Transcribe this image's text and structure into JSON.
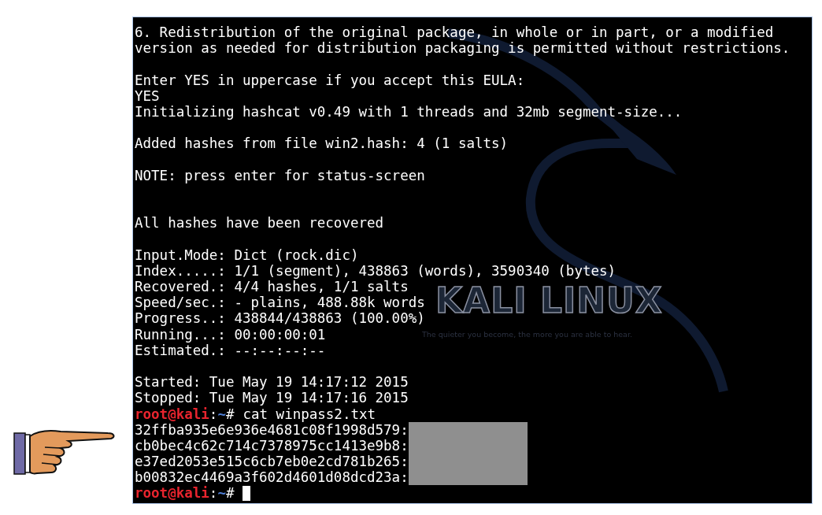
{
  "terminal": {
    "wallpaper": {
      "logo_text": "KALI LINUX",
      "tagline": "The quieter you become, the more you are able to hear."
    },
    "lines": [
      {
        "kind": "text",
        "text": "6. Redistribution of the original package, in whole or in part, or a modified"
      },
      {
        "kind": "text",
        "text": "version as needed for distribution packaging is permitted without restrictions."
      },
      {
        "kind": "blank"
      },
      {
        "kind": "text",
        "text": "Enter YES in uppercase if you accept this EULA:"
      },
      {
        "kind": "text",
        "text": "YES"
      },
      {
        "kind": "text",
        "text": "Initializing hashcat v0.49 with 1 threads and 32mb segment-size..."
      },
      {
        "kind": "blank"
      },
      {
        "kind": "text",
        "text": "Added hashes from file win2.hash: 4 (1 salts)"
      },
      {
        "kind": "blank"
      },
      {
        "kind": "text",
        "text": "NOTE: press enter for status-screen"
      },
      {
        "kind": "blank"
      },
      {
        "kind": "blank"
      },
      {
        "kind": "text",
        "text": "All hashes have been recovered"
      },
      {
        "kind": "blank"
      },
      {
        "kind": "text",
        "text": "Input.Mode: Dict (rock.dic)"
      },
      {
        "kind": "text",
        "text": "Index.....: 1/1 (segment), 438863 (words), 3590340 (bytes)"
      },
      {
        "kind": "text",
        "text": "Recovered.: 4/4 hashes, 1/1 salts"
      },
      {
        "kind": "text",
        "text": "Speed/sec.: - plains, 488.88k words"
      },
      {
        "kind": "text",
        "text": "Progress..: 438844/438863 (100.00%)"
      },
      {
        "kind": "text",
        "text": "Running...: 00:00:00:01"
      },
      {
        "kind": "text",
        "text": "Estimated.: --:--:--:--"
      },
      {
        "kind": "blank"
      },
      {
        "kind": "text",
        "text": "Started: Tue May 19 14:17:12 2015"
      },
      {
        "kind": "text",
        "text": "Stopped: Tue May 19 14:17:16 2015"
      },
      {
        "kind": "prompt",
        "user_host": "root@kali",
        "separator": ":",
        "path": "~",
        "symbol": "#",
        "command": "cat winpass2.txt"
      },
      {
        "kind": "hash",
        "text": "32ffba935e6e936e4681c08f1998d579:",
        "redacted": true
      },
      {
        "kind": "hash",
        "text": "cb0bec4c62c714c7378975cc1413e9b8:",
        "redacted": true
      },
      {
        "kind": "hash",
        "text": "e37ed2053e515c6cb7eb0e2cd781b265:",
        "redacted": true
      },
      {
        "kind": "hash",
        "text": "b00832ec4469a3f602d4601d08dcd23a:",
        "redacted": true
      },
      {
        "kind": "prompt",
        "user_host": "root@kali",
        "separator": ":",
        "path": "~",
        "symbol": "#",
        "cursor": true
      }
    ]
  }
}
